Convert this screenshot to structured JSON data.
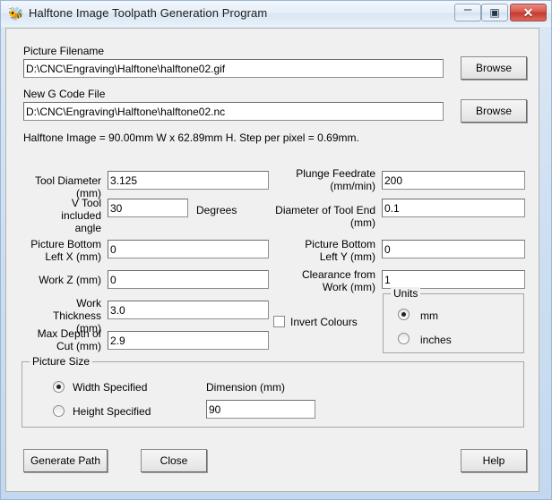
{
  "window": {
    "title": "Halftone Image Toolpath Generation Program",
    "icon": "bug-icon",
    "controls": {
      "minimize": "–",
      "maximize": "▣",
      "close": "✕"
    }
  },
  "picture_file": {
    "label": "Picture Filename",
    "value": "D:\\CNC\\Engraving\\Halftone\\halftone02.gif",
    "browse_label": "Browse"
  },
  "gcode_file": {
    "label": "New G Code File",
    "value": "D:\\CNC\\Engraving\\Halftone\\halftone02.nc",
    "browse_label": "Browse"
  },
  "info_line": "Halftone Image = 90.00mm W x 62.89mm H. Step per pixel = 0.69mm.",
  "fields": {
    "tool_diameter": {
      "label": "Tool Diameter (mm)",
      "value": "3.125"
    },
    "v_tool_angle": {
      "label": "V Tool included\nangle",
      "value": "30",
      "suffix": "Degrees"
    },
    "plunge_feedrate": {
      "label": "Plunge Feedrate\n(mm/min)",
      "value": "200"
    },
    "tool_end_diameter": {
      "label": "Diameter of Tool End (mm)",
      "value": "0.1"
    },
    "picture_bottom_left_x": {
      "label": "Picture Bottom\nLeft X (mm)",
      "value": "0"
    },
    "picture_bottom_left_y": {
      "label": "Picture Bottom\nLeft Y (mm)",
      "value": "0"
    },
    "work_z": {
      "label": "Work Z (mm)",
      "value": "0"
    },
    "clearance_from_work": {
      "label": "Clearance from\nWork (mm)",
      "value": "1"
    },
    "work_thickness": {
      "label": "Work Thickness\n(mm)",
      "value": "3.0"
    },
    "max_depth_of_cut": {
      "label": "Max Depth of\nCut (mm)",
      "value": "2.9"
    }
  },
  "invert_colours": {
    "label": "Invert Colours",
    "checked": false
  },
  "units": {
    "title": "Units",
    "options": [
      {
        "label": "mm",
        "selected": true
      },
      {
        "label": "inches",
        "selected": false
      }
    ]
  },
  "picture_size": {
    "title": "Picture Size",
    "options": [
      {
        "label": "Width Specified",
        "selected": true
      },
      {
        "label": "Height Specified",
        "selected": false
      }
    ],
    "dimension_label": "Dimension (mm)",
    "dimension_value": "90"
  },
  "actions": {
    "generate": "Generate Path",
    "close": "Close",
    "help": "Help"
  }
}
